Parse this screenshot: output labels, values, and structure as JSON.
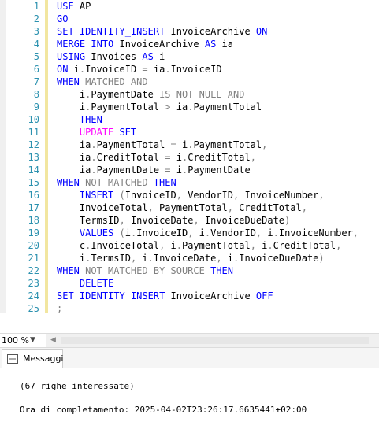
{
  "editor": {
    "lines": [
      {
        "n": "1",
        "tokens": [
          [
            "kw",
            "USE"
          ],
          [
            "id",
            " AP"
          ]
        ]
      },
      {
        "n": "2",
        "tokens": [
          [
            "kw",
            "GO"
          ]
        ]
      },
      {
        "n": "3",
        "tokens": [
          [
            "kw",
            "SET"
          ],
          [
            "id",
            " "
          ],
          [
            "kw",
            "IDENTITY_INSERT"
          ],
          [
            "id",
            " InvoiceArchive "
          ],
          [
            "kw",
            "ON"
          ]
        ]
      },
      {
        "n": "4",
        "tokens": [
          [
            "kw",
            "MERGE INTO"
          ],
          [
            "id",
            " InvoiceArchive "
          ],
          [
            "kw",
            "AS"
          ],
          [
            "id",
            " ia"
          ]
        ]
      },
      {
        "n": "5",
        "tokens": [
          [
            "kw",
            "USING"
          ],
          [
            "id",
            " Invoices "
          ],
          [
            "kw",
            "AS"
          ],
          [
            "id",
            " i"
          ]
        ]
      },
      {
        "n": "6",
        "tokens": [
          [
            "kw",
            "ON"
          ],
          [
            "id",
            " i"
          ],
          [
            "op",
            "."
          ],
          [
            "id",
            "InvoiceID "
          ],
          [
            "op",
            "="
          ],
          [
            "id",
            " ia"
          ],
          [
            "op",
            "."
          ],
          [
            "id",
            "InvoiceID"
          ]
        ]
      },
      {
        "n": "7",
        "tokens": [
          [
            "kw",
            "WHEN"
          ],
          [
            "op",
            " MATCHED AND"
          ]
        ]
      },
      {
        "n": "8",
        "tokens": [
          [
            "id",
            "    i"
          ],
          [
            "op",
            "."
          ],
          [
            "id",
            "PaymentDate "
          ],
          [
            "op",
            "IS NOT NULL AND"
          ]
        ]
      },
      {
        "n": "9",
        "tokens": [
          [
            "id",
            "    i"
          ],
          [
            "op",
            "."
          ],
          [
            "id",
            "PaymentTotal "
          ],
          [
            "op",
            ">"
          ],
          [
            "id",
            " ia"
          ],
          [
            "op",
            "."
          ],
          [
            "id",
            "PaymentTotal"
          ]
        ]
      },
      {
        "n": "10",
        "tokens": [
          [
            "kw",
            "    THEN"
          ]
        ]
      },
      {
        "n": "11",
        "tokens": [
          [
            "fn",
            "    UPDATE"
          ],
          [
            "id",
            " "
          ],
          [
            "kw",
            "SET"
          ]
        ]
      },
      {
        "n": "12",
        "tokens": [
          [
            "id",
            "    ia"
          ],
          [
            "op",
            "."
          ],
          [
            "id",
            "PaymentTotal "
          ],
          [
            "op",
            "="
          ],
          [
            "id",
            " i"
          ],
          [
            "op",
            "."
          ],
          [
            "id",
            "PaymentTotal"
          ],
          [
            "op",
            ","
          ]
        ]
      },
      {
        "n": "13",
        "tokens": [
          [
            "id",
            "    ia"
          ],
          [
            "op",
            "."
          ],
          [
            "id",
            "CreditTotal "
          ],
          [
            "op",
            "="
          ],
          [
            "id",
            " i"
          ],
          [
            "op",
            "."
          ],
          [
            "id",
            "CreditTotal"
          ],
          [
            "op",
            ","
          ]
        ]
      },
      {
        "n": "14",
        "tokens": [
          [
            "id",
            "    ia"
          ],
          [
            "op",
            "."
          ],
          [
            "id",
            "PaymentDate "
          ],
          [
            "op",
            "="
          ],
          [
            "id",
            " i"
          ],
          [
            "op",
            "."
          ],
          [
            "id",
            "PaymentDate"
          ]
        ]
      },
      {
        "n": "15",
        "tokens": [
          [
            "kw",
            "WHEN"
          ],
          [
            "op",
            " NOT MATCHED "
          ],
          [
            "kw",
            "THEN"
          ]
        ]
      },
      {
        "n": "16",
        "tokens": [
          [
            "kw",
            "    INSERT"
          ],
          [
            "op",
            " ("
          ],
          [
            "id",
            "InvoiceID"
          ],
          [
            "op",
            ","
          ],
          [
            "id",
            " VendorID"
          ],
          [
            "op",
            ","
          ],
          [
            "id",
            " InvoiceNumber"
          ],
          [
            "op",
            ","
          ]
        ]
      },
      {
        "n": "17",
        "tokens": [
          [
            "id",
            "    InvoiceTotal"
          ],
          [
            "op",
            ","
          ],
          [
            "id",
            " PaymentTotal"
          ],
          [
            "op",
            ","
          ],
          [
            "id",
            " CreditTotal"
          ],
          [
            "op",
            ","
          ]
        ]
      },
      {
        "n": "18",
        "tokens": [
          [
            "id",
            "    TermsID"
          ],
          [
            "op",
            ","
          ],
          [
            "id",
            " InvoiceDate"
          ],
          [
            "op",
            ","
          ],
          [
            "id",
            " InvoiceDueDate"
          ],
          [
            "op",
            ")"
          ]
        ]
      },
      {
        "n": "19",
        "tokens": [
          [
            "kw",
            "    VALUES"
          ],
          [
            "op",
            " ("
          ],
          [
            "id",
            "i"
          ],
          [
            "op",
            "."
          ],
          [
            "id",
            "InvoiceID"
          ],
          [
            "op",
            ","
          ],
          [
            "id",
            " i"
          ],
          [
            "op",
            "."
          ],
          [
            "id",
            "VendorID"
          ],
          [
            "op",
            ","
          ],
          [
            "id",
            " i"
          ],
          [
            "op",
            "."
          ],
          [
            "id",
            "InvoiceNumber"
          ],
          [
            "op",
            ","
          ]
        ]
      },
      {
        "n": "20",
        "tokens": [
          [
            "id",
            "    c"
          ],
          [
            "op",
            "."
          ],
          [
            "id",
            "InvoiceTotal"
          ],
          [
            "op",
            ","
          ],
          [
            "id",
            " i"
          ],
          [
            "op",
            "."
          ],
          [
            "id",
            "PaymentTotal"
          ],
          [
            "op",
            ","
          ],
          [
            "id",
            " i"
          ],
          [
            "op",
            "."
          ],
          [
            "id",
            "CreditTotal"
          ],
          [
            "op",
            ","
          ]
        ]
      },
      {
        "n": "21",
        "tokens": [
          [
            "id",
            "    i"
          ],
          [
            "op",
            "."
          ],
          [
            "id",
            "TermsID"
          ],
          [
            "op",
            ","
          ],
          [
            "id",
            " i"
          ],
          [
            "op",
            "."
          ],
          [
            "id",
            "InvoiceDate"
          ],
          [
            "op",
            ","
          ],
          [
            "id",
            " i"
          ],
          [
            "op",
            "."
          ],
          [
            "id",
            "InvoiceDueDate"
          ],
          [
            "op",
            ")"
          ]
        ]
      },
      {
        "n": "22",
        "tokens": [
          [
            "kw",
            "WHEN"
          ],
          [
            "op",
            " NOT MATCHED BY SOURCE "
          ],
          [
            "kw",
            "THEN"
          ]
        ]
      },
      {
        "n": "23",
        "tokens": [
          [
            "kw",
            "    DELETE"
          ]
        ]
      },
      {
        "n": "24",
        "tokens": [
          [
            "kw",
            "SET"
          ],
          [
            "id",
            " "
          ],
          [
            "kw",
            "IDENTITY_INSERT"
          ],
          [
            "id",
            " InvoiceArchive "
          ],
          [
            "kw",
            "OFF"
          ]
        ]
      },
      {
        "n": "25",
        "tokens": [
          [
            "op",
            ";"
          ]
        ]
      }
    ]
  },
  "zoom": {
    "value": "100 %"
  },
  "results": {
    "tab_label": "Messaggi",
    "messages": [
      "(67 righe interessate)",
      "Ora di completamento: 2025-04-02T23:26:17.6635441+02:00"
    ]
  },
  "colors": {
    "keyword": "#0000ff",
    "operator": "#808080",
    "function": "#ff00ff",
    "line_number": "#2b91af"
  }
}
